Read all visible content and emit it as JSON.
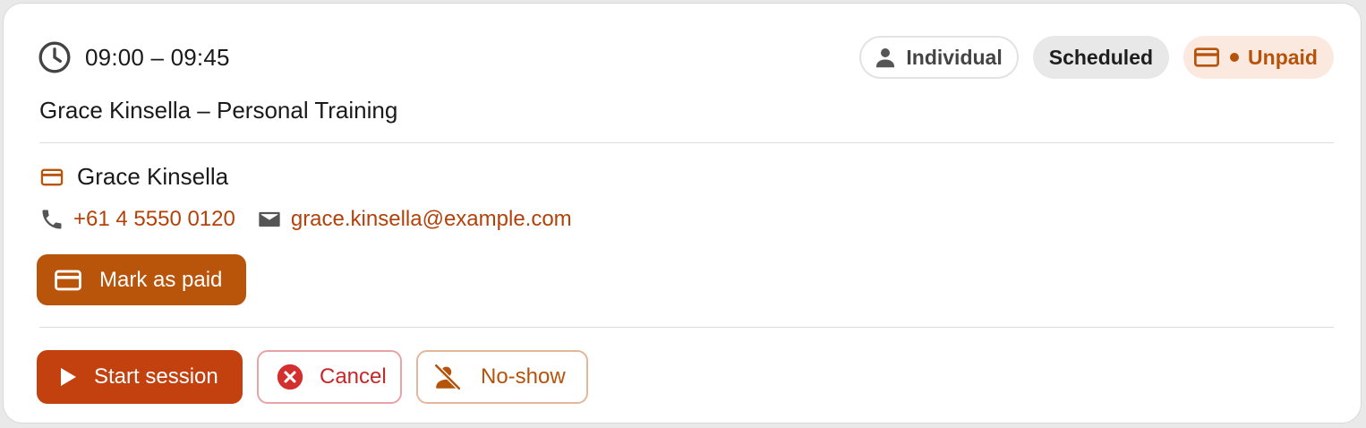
{
  "appointment": {
    "time_range": "09:00 – 09:45",
    "title": "Grace Kinsella – Personal Training"
  },
  "badges": {
    "type_label": "Individual",
    "status_label": "Scheduled",
    "payment_label": "Unpaid"
  },
  "client": {
    "name": "Grace Kinsella",
    "phone": "+61 4 5550 0120",
    "email": "grace.kinsella@example.com"
  },
  "actions": {
    "mark_paid_label": "Mark as paid",
    "start_label": "Start session",
    "cancel_label": "Cancel",
    "noshow_label": "No-show"
  },
  "icons": {
    "time": "clock-icon",
    "type": "person-icon",
    "payment": "credit-card-icon",
    "phone": "phone-icon",
    "email": "mail-icon",
    "start": "play-icon",
    "cancel": "cancel-circle-icon",
    "noshow": "person-off-icon"
  },
  "colors": {
    "accent": "#b9540b",
    "primary": "#c3410f",
    "danger": "#c62828",
    "link": "#b3420a",
    "unpaid_bg": "#fbe9e0"
  }
}
